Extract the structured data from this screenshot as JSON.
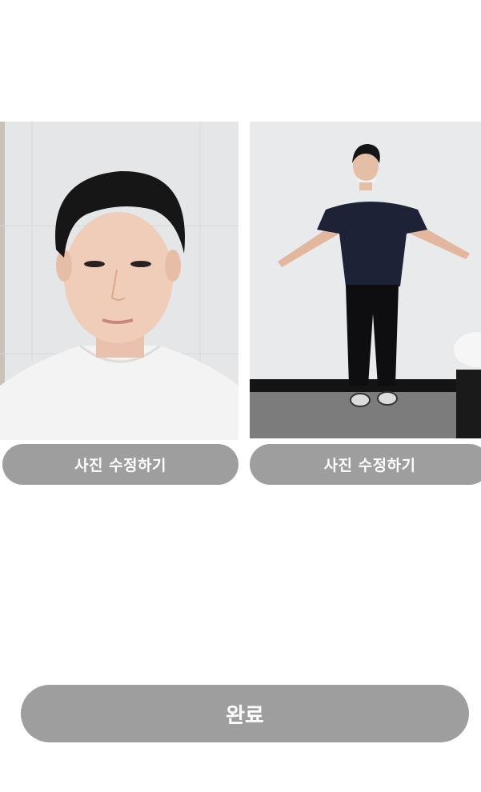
{
  "photos": [
    {
      "kind": "face-photo",
      "edit_label": "사진 수정하기"
    },
    {
      "kind": "full-body-photo",
      "edit_label": "사진 수정하기"
    }
  ],
  "footer": {
    "complete_label": "완료"
  },
  "colors": {
    "button_bg": "#9e9e9e",
    "button_text": "#ffffff",
    "page_bg": "#ffffff"
  }
}
